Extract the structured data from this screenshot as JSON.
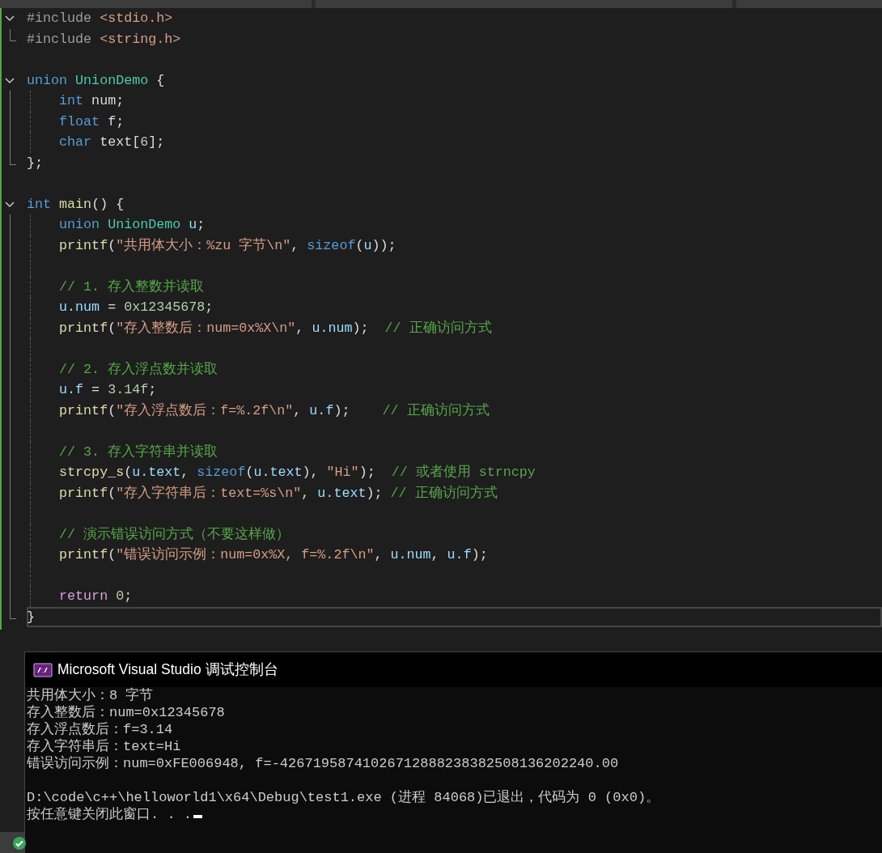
{
  "editor": {
    "lines": [
      {
        "expanded": true,
        "current": false,
        "tokens": [
          {
            "kind": "pre",
            "text": "#include "
          },
          {
            "kind": "str",
            "text": "<stdio.h>"
          }
        ],
        "children": [
          {
            "current": false,
            "tokens": [
              {
                "kind": "pre",
                "text": "#include "
              },
              {
                "kind": "str",
                "text": "<string.h>"
              }
            ]
          }
        ]
      },
      {
        "current": false
      },
      {
        "expanded": true,
        "current": false,
        "tokens": [
          {
            "kind": "kw",
            "text": "union "
          },
          {
            "kind": "type",
            "text": "UnionDemo"
          },
          {
            "kind": "txt",
            "text": " {"
          }
        ],
        "children": [
          {
            "current": false,
            "tokens": [
              {
                "kind": "kw",
                "text": "    int"
              },
              {
                "kind": "txt",
                "text": " num;"
              }
            ]
          },
          {
            "current": false,
            "tokens": [
              {
                "kind": "kw",
                "text": "    float"
              },
              {
                "kind": "txt",
                "text": " f;"
              }
            ]
          },
          {
            "current": false,
            "tokens": [
              {
                "kind": "kw",
                "text": "    char"
              },
              {
                "kind": "txt",
                "text": " text["
              },
              {
                "kind": "num",
                "text": "6"
              },
              {
                "kind": "txt",
                "text": "];"
              }
            ]
          },
          {
            "current": false,
            "tokens": [
              {
                "kind": "txt",
                "text": "};"
              }
            ]
          }
        ]
      },
      {
        "current": false
      },
      {
        "expanded": true,
        "current": false,
        "tokens": [
          {
            "kind": "kw",
            "text": "int "
          },
          {
            "kind": "fn",
            "text": "main"
          },
          {
            "kind": "txt",
            "text": "() {"
          }
        ],
        "children": [
          {
            "current": false,
            "tokens": [
              {
                "kind": "kw",
                "text": "    union "
              },
              {
                "kind": "type",
                "text": "UnionDemo "
              },
              {
                "kind": "mem",
                "text": "u"
              },
              {
                "kind": "txt",
                "text": ";"
              }
            ]
          },
          {
            "current": false,
            "tokens": [
              {
                "kind": "fn",
                "text": "    printf"
              },
              {
                "kind": "txt",
                "text": "("
              },
              {
                "kind": "str",
                "text": "\"共用体大小：%zu 字节\\n\""
              },
              {
                "kind": "txt",
                "text": ", "
              },
              {
                "kind": "kw",
                "text": "sizeof"
              },
              {
                "kind": "txt",
                "text": "("
              },
              {
                "kind": "mem",
                "text": "u"
              },
              {
                "kind": "txt",
                "text": "));"
              }
            ]
          },
          {
            "current": false
          },
          {
            "current": false,
            "tokens": [
              {
                "kind": "cmt",
                "text": "    // 1. 存入整数并读取"
              }
            ]
          },
          {
            "current": false,
            "tokens": [
              {
                "kind": "mem",
                "text": "    u.num"
              },
              {
                "kind": "txt",
                "text": " = "
              },
              {
                "kind": "num",
                "text": "0x12345678"
              },
              {
                "kind": "txt",
                "text": ";"
              }
            ]
          },
          {
            "current": false,
            "tokens": [
              {
                "kind": "fn",
                "text": "    printf"
              },
              {
                "kind": "txt",
                "text": "("
              },
              {
                "kind": "str",
                "text": "\"存入整数后：num=0x%X\\n\""
              },
              {
                "kind": "txt",
                "text": ", "
              },
              {
                "kind": "mem",
                "text": "u.num"
              },
              {
                "kind": "txt",
                "text": ");  "
              },
              {
                "kind": "cmt",
                "text": "// 正确访问方式"
              }
            ]
          },
          {
            "current": false
          },
          {
            "current": false,
            "tokens": [
              {
                "kind": "cmt",
                "text": "    // 2. 存入浮点数并读取"
              }
            ]
          },
          {
            "current": false,
            "tokens": [
              {
                "kind": "mem",
                "text": "    u.f"
              },
              {
                "kind": "txt",
                "text": " = "
              },
              {
                "kind": "num",
                "text": "3.14f"
              },
              {
                "kind": "txt",
                "text": ";"
              }
            ]
          },
          {
            "current": false,
            "tokens": [
              {
                "kind": "fn",
                "text": "    printf"
              },
              {
                "kind": "txt",
                "text": "("
              },
              {
                "kind": "str",
                "text": "\"存入浮点数后：f=%.2f\\n\""
              },
              {
                "kind": "txt",
                "text": ", "
              },
              {
                "kind": "mem",
                "text": "u.f"
              },
              {
                "kind": "txt",
                "text": ");    "
              },
              {
                "kind": "cmt",
                "text": "// 正确访问方式"
              }
            ]
          },
          {
            "current": false
          },
          {
            "current": false,
            "tokens": [
              {
                "kind": "cmt",
                "text": "    // 3. 存入字符串并读取"
              }
            ]
          },
          {
            "current": false,
            "tokens": [
              {
                "kind": "fn",
                "text": "    strcpy_s"
              },
              {
                "kind": "txt",
                "text": "("
              },
              {
                "kind": "mem",
                "text": "u.text"
              },
              {
                "kind": "txt",
                "text": ", "
              },
              {
                "kind": "kw",
                "text": "sizeof"
              },
              {
                "kind": "txt",
                "text": "("
              },
              {
                "kind": "mem",
                "text": "u.text"
              },
              {
                "kind": "txt",
                "text": "), "
              },
              {
                "kind": "str",
                "text": "\"Hi\""
              },
              {
                "kind": "txt",
                "text": ");  "
              },
              {
                "kind": "cmt",
                "text": "// 或者使用 strncpy"
              }
            ]
          },
          {
            "current": false,
            "tokens": [
              {
                "kind": "fn",
                "text": "    printf"
              },
              {
                "kind": "txt",
                "text": "("
              },
              {
                "kind": "str",
                "text": "\"存入字符串后：text=%s\\n\""
              },
              {
                "kind": "txt",
                "text": ", "
              },
              {
                "kind": "mem",
                "text": "u.text"
              },
              {
                "kind": "txt",
                "text": "); "
              },
              {
                "kind": "cmt",
                "text": "// 正确访问方式"
              }
            ]
          },
          {
            "current": false
          },
          {
            "current": false,
            "tokens": [
              {
                "kind": "cmt",
                "text": "    // 演示错误访问方式（不要这样做）"
              }
            ]
          },
          {
            "current": false,
            "tokens": [
              {
                "kind": "fn",
                "text": "    printf"
              },
              {
                "kind": "txt",
                "text": "("
              },
              {
                "kind": "str",
                "text": "\"错误访问示例：num=0x%X, f=%.2f\\n\""
              },
              {
                "kind": "txt",
                "text": ", "
              },
              {
                "kind": "mem",
                "text": "u.num"
              },
              {
                "kind": "txt",
                "text": ", "
              },
              {
                "kind": "mem",
                "text": "u.f"
              },
              {
                "kind": "txt",
                "text": ");"
              }
            ]
          },
          {
            "current": false
          },
          {
            "current": false,
            "tokens": [
              {
                "kind": "ctrl",
                "text": "    return"
              },
              {
                "kind": "num",
                "text": " 0"
              },
              {
                "kind": "txt",
                "text": ";"
              }
            ]
          },
          {
            "current": true,
            "tokens": [
              {
                "kind": "txt",
                "text": "}"
              }
            ]
          }
        ]
      }
    ]
  },
  "console": {
    "title": "Microsoft Visual Studio 调试控制台",
    "output_groups": [
      [
        "共用体大小：8 字节",
        "存入整数后：num=0x12345678",
        "存入浮点数后：f=3.14",
        "存入字符串后：text=Hi",
        "错误访问示例：num=0xFE006948, f=-42671958741026712888238382508136202240.00"
      ],
      [
        "D:\\code\\c++\\helloworld1\\x64\\Debug\\test1.exe (进程 84068)已退出，代码为 0 (0x0)。",
        "按任意键关闭此窗口. . ."
      ]
    ],
    "cursor_visible": true
  }
}
